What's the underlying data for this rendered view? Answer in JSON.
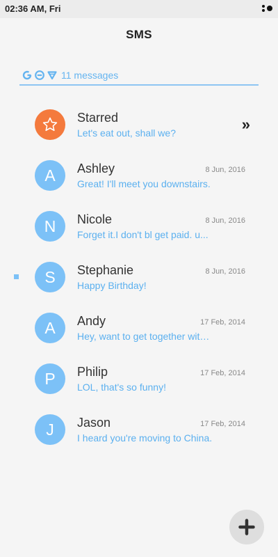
{
  "status_bar": {
    "time": "02:36 AM, Fri"
  },
  "header": {
    "title": "SMS"
  },
  "filter_bar": {
    "count_label": "11 messages",
    "icons": [
      "refresh-icon",
      "minus-circle-icon",
      "filter-icon"
    ]
  },
  "colors": {
    "accent": "#64b4f0",
    "avatar": "#7cc1f7",
    "starred_avatar": "#f47a3d",
    "underline": "#8ec5f2"
  },
  "starred": {
    "name": "Starred",
    "preview": "Let's eat out, shall we?",
    "icon": "star-icon",
    "arrow": "»"
  },
  "conversations": [
    {
      "initial": "A",
      "name": "Ashley",
      "date": "8 Jun, 2016",
      "preview": "Great! I'll meet you downstairs."
    },
    {
      "initial": "N",
      "name": "Nicole",
      "date": "8 Jun, 2016",
      "preview": "Forget it.I don't bl get paid. u..."
    },
    {
      "initial": "S",
      "name": "Stephanie",
      "date": "8 Jun, 2016",
      "preview": "Happy Birthday!"
    },
    {
      "initial": "A",
      "name": "Andy",
      "date": "17 Feb, 2014",
      "preview": "Hey, want to get together with us?"
    },
    {
      "initial": "P",
      "name": "Philip",
      "date": "17 Feb, 2014",
      "preview": "LOL, that's so funny!"
    },
    {
      "initial": "J",
      "name": "Jason",
      "date": "17 Feb, 2014",
      "preview": "I heard you're moving to China."
    }
  ],
  "fab": {
    "icon": "plus-icon"
  }
}
